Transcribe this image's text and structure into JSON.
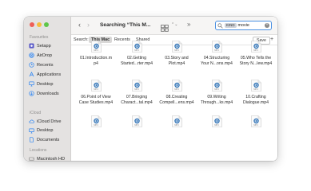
{
  "window": {
    "title": "Searching “This M...",
    "back_icon": "chevron-left-icon",
    "forward_icon": "chevron-right-icon",
    "more_label": "»"
  },
  "sidebar": {
    "favorites_header": "Favourites",
    "favorites": [
      {
        "label": "Setapp",
        "icon": "setapp-icon",
        "color": "#5a5ac8"
      },
      {
        "label": "AirDrop",
        "icon": "airdrop-icon",
        "color": "#2f86f2"
      },
      {
        "label": "Recents",
        "icon": "clock-icon",
        "color": "#2f86f2"
      },
      {
        "label": "Applications",
        "icon": "applications-icon",
        "color": "#2f86f2"
      },
      {
        "label": "Desktop",
        "icon": "desktop-icon",
        "color": "#2f86f2"
      },
      {
        "label": "Downloads",
        "icon": "downloads-icon",
        "color": "#2f86f2"
      }
    ],
    "icloud_header": "iCloud",
    "icloud": [
      {
        "label": "iCloud Drive",
        "icon": "cloud-icon",
        "color": "#2f86f2"
      },
      {
        "label": "Desktop",
        "icon": "desktop-icon",
        "color": "#2f86f2"
      },
      {
        "label": "Documents",
        "icon": "document-icon",
        "color": "#2f86f2"
      }
    ],
    "locations_header": "Locations",
    "locations": [
      {
        "label": "Macintosh HD",
        "icon": "disk-icon",
        "color": "#8a8a8a"
      }
    ]
  },
  "search": {
    "token": "KIND",
    "query": "movie",
    "clear_icon": "clear-icon",
    "accent": "#4a90e2"
  },
  "scope": {
    "label": "Search:",
    "options": [
      "This Mac",
      "Recents",
      "Shared"
    ],
    "active": "This Mac",
    "save_label": "Save",
    "add_label": "+"
  },
  "files": [
    {
      "name": "01.Introduction.m\np4"
    },
    {
      "name": "02.Getting\nStarted...rter.mp4"
    },
    {
      "name": "03.Story and\nPlot.mp4"
    },
    {
      "name": "04.Structuring\nYour N...ons.mp4"
    },
    {
      "name": "05.Who Tells the\nStory N...lew.mp4"
    },
    {
      "name": "06.Point of View\nCase Studies.mp4"
    },
    {
      "name": "07.Bringing\nCharact...tal.mp4"
    },
    {
      "name": "08.Creating\nCompell...ens.mp4"
    },
    {
      "name": "09.Writing\nThrough...ks.mp4"
    },
    {
      "name": "10.Crafting\nDialogue.mp4"
    },
    {
      "name": ""
    },
    {
      "name": ""
    },
    {
      "name": ""
    },
    {
      "name": ""
    },
    {
      "name": ""
    }
  ],
  "file_icon": {
    "name": "quicktime-movie-icon",
    "badge": "MP4"
  }
}
